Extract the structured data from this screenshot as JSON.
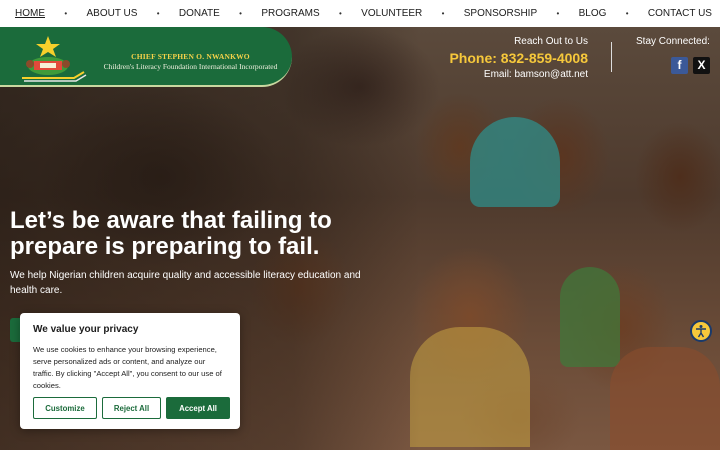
{
  "nav": {
    "items": [
      "HOME",
      "ABOUT US",
      "DONATE",
      "PROGRAMS",
      "VOLUNTEER",
      "SPONSORSHIP",
      "BLOG",
      "CONTACT US"
    ],
    "separator": "•"
  },
  "brand": {
    "name": "CHIEF STEPHEN O. NWANKWO",
    "subtitle": "Children's Literacy Foundation International Incorporated"
  },
  "contact": {
    "reach_label": "Reach Out to Us",
    "phone": "Phone: 832-859-4008",
    "email": "Email: bamson@att.net",
    "stay_label": "Stay Connected:"
  },
  "social": {
    "facebook_glyph": "f",
    "x_glyph": "X"
  },
  "hero": {
    "headline": "Let’s be aware that failing to prepare is preparing to fail.",
    "subtext": "We help Nigerian children acquire quality and accessible literacy education and health care."
  },
  "cookie": {
    "title": "We value your privacy",
    "body": "We use cookies to enhance your browsing experience, serve personalized ads or content, and analyze our traffic. By clicking \"Accept All\", you consent to our use of cookies.",
    "customize": "Customize",
    "reject": "Reject All",
    "accept": "Accept All"
  },
  "colors": {
    "brand_green": "#1b6b3b",
    "phone_yellow": "#f6c83b"
  }
}
